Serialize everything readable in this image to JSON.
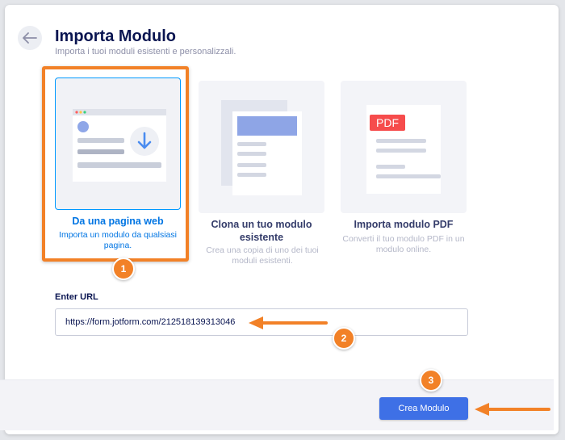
{
  "header": {
    "title": "Importa Modulo",
    "subtitle": "Importa i tuoi moduli esistenti e personalizzali."
  },
  "options": [
    {
      "title": "Da una pagina web",
      "description": "Importa un modulo da qualsiasi pagina.",
      "selected": true,
      "icon": "webpage-download-icon"
    },
    {
      "title": "Clona un tuo modulo esistente",
      "description": "Crea una copia di uno dei tuoi moduli esistenti.",
      "selected": false,
      "icon": "clone-form-icon"
    },
    {
      "title": "Importa modulo PDF",
      "description": "Converti il tuo modulo PDF in un modulo online.",
      "selected": false,
      "icon": "pdf-document-icon",
      "icon_text": "PDF"
    }
  ],
  "url_field": {
    "label": "Enter URL",
    "value": "https://form.jotform.com/212518139313046"
  },
  "footer": {
    "create_label": "Crea Modulo"
  },
  "annotations": {
    "step1": "1",
    "step2": "2",
    "step3": "3"
  },
  "colors": {
    "accent": "#f28127",
    "primary_button": "#3e70e6",
    "selected_text": "#0075e3",
    "title": "#0a1551"
  }
}
